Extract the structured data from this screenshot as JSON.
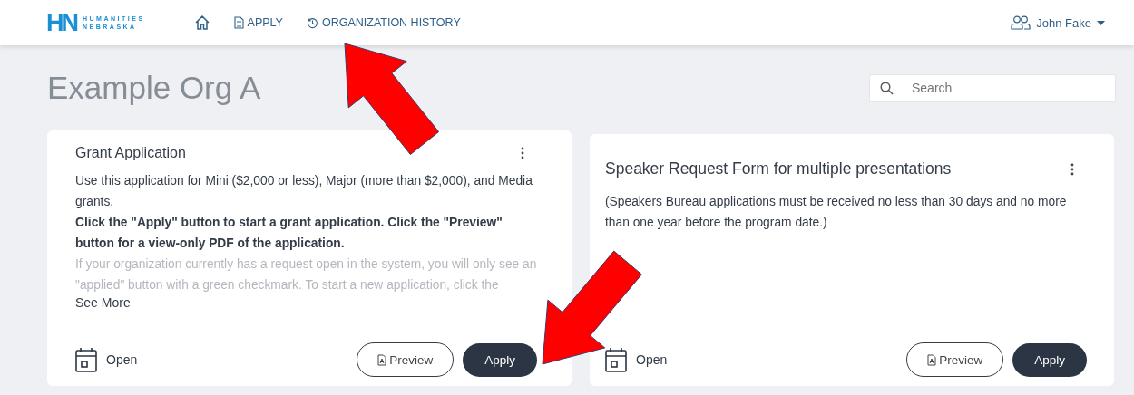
{
  "header": {
    "logo": {
      "mark": "HN",
      "line_1": "HUMANITIES",
      "line_2": "NEBRASKA"
    },
    "nav": [
      {
        "kind": "home"
      },
      {
        "kind": "doc",
        "label": "APPLY"
      },
      {
        "kind": "history",
        "label": "ORGANIZATION HISTORY"
      }
    ],
    "user": {
      "name": "John Fake"
    }
  },
  "page": {
    "title": "Example Org A",
    "search": {
      "placeholder": "Search"
    }
  },
  "cards": [
    {
      "title": "Grant Application",
      "title_link": true,
      "paragraphs": [
        {
          "kind": "normal",
          "text": "Use this application for Mini ($2,000 or less), Major (more than $2,000), and Media grants."
        },
        {
          "kind": "bold",
          "text": "Click the \"Apply\" button to start a grant application. Click the \"Preview\" button for a view-only PDF of the application."
        },
        {
          "kind": "faded",
          "text": "If your organization currently has a request open in the system, you will only see an \"applied\" button with a green checkmark. To start a new application, click the"
        }
      ],
      "see_more": "See More",
      "status": "Open",
      "preview": "Preview",
      "apply": "Apply"
    },
    {
      "title": "Speaker Request Form for multiple presentations",
      "title_link": false,
      "paragraphs": [
        {
          "kind": "normal",
          "text": "(Speakers Bureau applications must be received no less than 30 days and no more than one year before the program date.)"
        }
      ],
      "status": "Open",
      "preview": "Preview",
      "apply": "Apply"
    }
  ]
}
